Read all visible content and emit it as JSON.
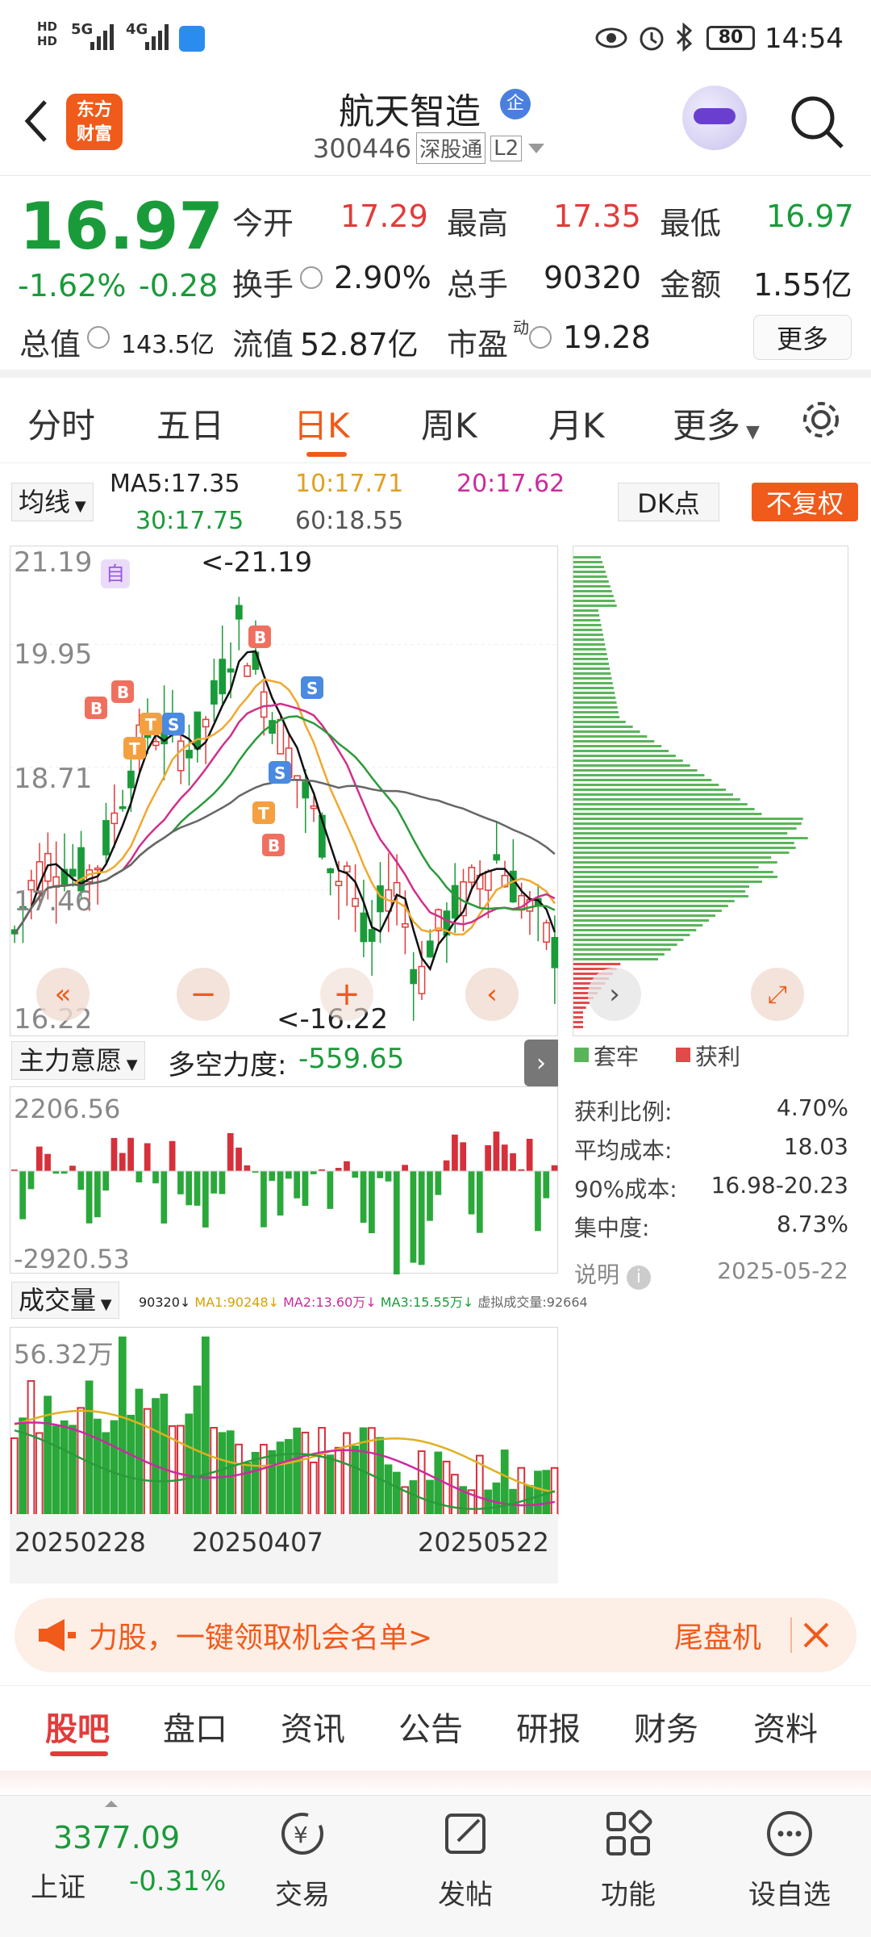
{
  "status": {
    "net1": "HD",
    "net2": "HD",
    "sig1": "5G",
    "sig2": "4G",
    "battery": "80",
    "time": "14:54"
  },
  "header": {
    "title": "航天智造",
    "badge": "企",
    "code": "300446",
    "market": "深股通",
    "level": "L2"
  },
  "quote": {
    "price": "16.97",
    "pct": "-1.62%",
    "chg": "-0.28",
    "open_label": "今开",
    "open": "17.29",
    "high_label": "最高",
    "high": "17.35",
    "low_label": "最低",
    "low": "16.97",
    "turnover_label": "换手",
    "turnover": "2.90%",
    "vol_label": "总手",
    "vol": "90320",
    "amt_label": "金额",
    "amt": "1.55亿",
    "mcap_label": "总值",
    "mcap": "143.5亿",
    "float_label": "流值",
    "float": "52.87亿",
    "pe_label": "市盈",
    "pe_sup": "动",
    "pe": "19.28",
    "more": "更多"
  },
  "ktabs": [
    "分时",
    "五日",
    "日K",
    "周K",
    "月K",
    "更多"
  ],
  "ma": {
    "sel": "均线",
    "ma5": "MA5:17.35",
    "ma10": "10:17.71",
    "ma20": "20:17.62",
    "ma30": "30:17.75",
    "ma60": "60:18.55",
    "dk": "DK点",
    "fq": "不复权"
  },
  "kchart": {
    "y1": "21.19",
    "y2": "19.95",
    "y3": "18.71",
    "y4": "17.46",
    "y5": "16.22",
    "hi": "<-21.19",
    "lo": "<-16.22",
    "self": "自"
  },
  "indicator": {
    "sel": "主力意愿",
    "label": "多空力度:",
    "value": "-559.65",
    "ymax": "2206.56",
    "ymin": "-2920.53"
  },
  "volume": {
    "sel": "成交量",
    "ymax": "56.32万",
    "info": [
      {
        "t": "90320↓",
        "c": "#222"
      },
      {
        "t": "MA1:90248↓",
        "c": "#d9a100"
      },
      {
        "t": "MA2:13.60万↓",
        "c": "#cc2aa0"
      },
      {
        "t": "MA3:15.55万↓",
        "c": "#1a9b3a"
      },
      {
        "t": "虚拟成交量:92664",
        "c": "#666"
      }
    ],
    "dates": [
      "20250228",
      "20250407",
      "20250522"
    ]
  },
  "chip": {
    "legend1": "套牢",
    "legend2": "获利",
    "rows": [
      {
        "k": "获利比例:",
        "v": "4.70%"
      },
      {
        "k": "平均成本:",
        "v": "18.03"
      },
      {
        "k": "90%成本:",
        "v": "16.98-20.23"
      },
      {
        "k": "集中度:",
        "v": "8.73%"
      }
    ],
    "note": "说明",
    "date": "2025-05-22"
  },
  "banner": {
    "text": "力股，一键领取机会名单>",
    "right": "尾盘机"
  },
  "bottomtabs": [
    "股吧",
    "盘口",
    "资讯",
    "公告",
    "研报",
    "财务",
    "资料"
  ],
  "nav": {
    "index_val": "3377.09",
    "index_name": "上证",
    "index_pct": "-0.31%",
    "trade": "交易",
    "post": "发帖",
    "func": "功能",
    "watch": "设自选"
  },
  "colors": {
    "up": "#e23b3b",
    "down": "#1a9b3a",
    "accent": "#f05a1a"
  }
}
